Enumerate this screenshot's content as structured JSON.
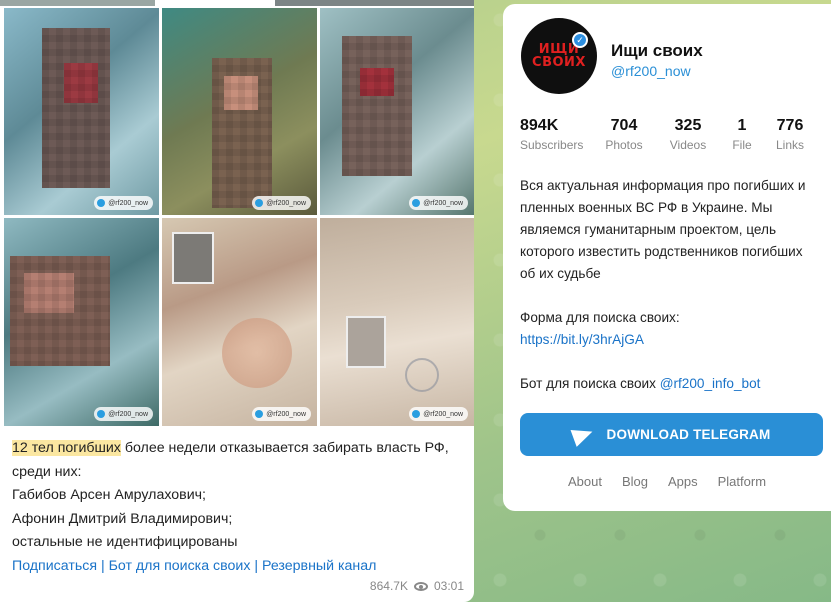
{
  "post": {
    "watermark": "@rf200_now",
    "caption": {
      "highlight": "12 тел погибших",
      "rest": " более недели отказывается забирать власть РФ, среди них:",
      "line2": "Габибов Арсен Амрулахович;",
      "line3": "Афонин Дмитрий Владимирович;",
      "line4": "остальные не идентифицированы"
    },
    "links": [
      "Подписаться",
      "Бот для поиска своих",
      "Резервный канал"
    ],
    "separator": " | ",
    "views": "864.7K",
    "time": "03:01"
  },
  "channel": {
    "avatar_line1": "ИЩИ",
    "avatar_line2": "СВОИХ",
    "name": "Ищи своих",
    "handle": "@rf200_now",
    "stats": [
      {
        "value": "894K",
        "label": "Subscribers"
      },
      {
        "value": "704",
        "label": "Photos"
      },
      {
        "value": "325",
        "label": "Videos"
      },
      {
        "value": "1",
        "label": "File"
      },
      {
        "value": "776",
        "label": "Links"
      }
    ],
    "description": "Вся актуальная информация про погибших и пленных военных ВС РФ в Украине. Мы являемся гуманитарным проектом, цель которого известить родственников погибших об их судьбе",
    "form_label": "Форма для поиска своих:",
    "form_link": "https://bit.ly/3hrAjGA",
    "bot_label": "Бот для поиска своих ",
    "bot_link": "@rf200_info_bot",
    "download_button": "DOWNLOAD TELEGRAM",
    "footer": [
      "About",
      "Blog",
      "Apps",
      "Platform"
    ]
  },
  "icons": {
    "verified": "verified-check-icon",
    "views": "eye-icon",
    "telegram": "paper-plane-icon"
  },
  "colors": {
    "accent": "#2a8fd6",
    "highlight": "#fbe7a1",
    "avatar_text": "#e02020"
  }
}
